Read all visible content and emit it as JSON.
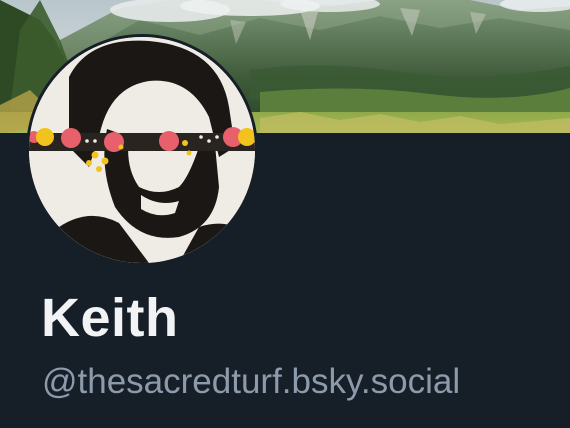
{
  "profile": {
    "display_name": "Keith",
    "handle": "@thesacredturf.bsky.social"
  },
  "banner": {
    "icon": "mountain-landscape-banner",
    "colors": {
      "sky": "#cfd8dc",
      "mountain": "#4f6b4a",
      "meadow": "#7e9a3c"
    }
  },
  "avatar": {
    "icon": "terminator-avatar",
    "colors": {
      "background": "#e8e4dc",
      "ink": "#1b1714",
      "lens_red": "#e8606b",
      "lens_yellow": "#f2c21d"
    }
  },
  "theme": {
    "page_bg": "#161e27",
    "name_color": "#f1f3f5",
    "handle_color": "#8d9aab"
  }
}
